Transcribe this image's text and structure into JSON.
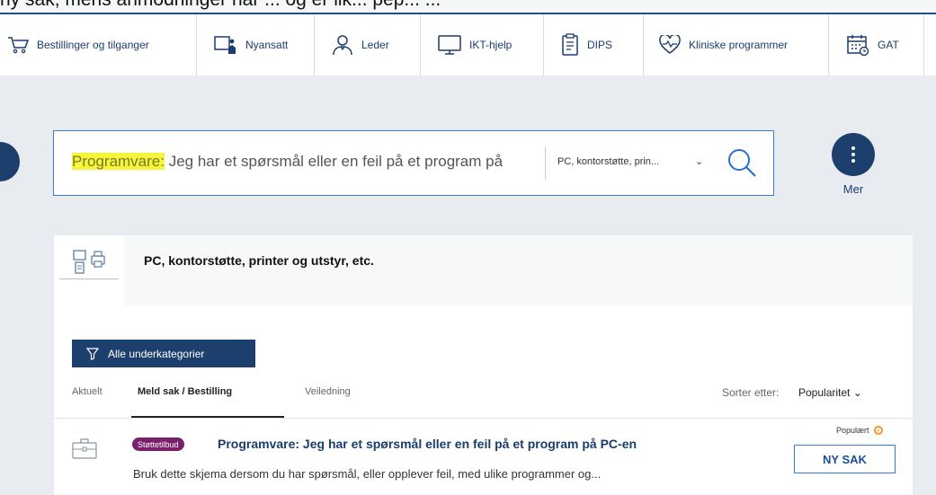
{
  "top_crop_text": "ny sak, mens anmodninger har ... og er lik... pep... ...",
  "nav": {
    "items": [
      {
        "label": "Bestillinger og tilganger",
        "icon": "cart-icon"
      },
      {
        "label": "Nyansatt",
        "icon": "new-employee-icon"
      },
      {
        "label": "Leder",
        "icon": "manager-icon"
      },
      {
        "label": "IKT-hjelp",
        "icon": "monitor-icon"
      },
      {
        "label": "DIPS",
        "icon": "clipboard-icon"
      },
      {
        "label": "Kliniske programmer",
        "icon": "heartbeat-icon"
      },
      {
        "label": "GAT",
        "icon": "calendar-icon"
      }
    ]
  },
  "search": {
    "highlight": "Programvare:",
    "query": " Jeg har et spørsmål eller en feil på et program på",
    "category": "PC, kontorstøtte, prin...",
    "chevron": "⌄"
  },
  "more": {
    "label": "Mer"
  },
  "category": {
    "title": "PC, kontorstøtte, printer og utstyr, etc."
  },
  "subcategories_button": "Alle underkategorier",
  "tabs": [
    {
      "label": "Aktuelt",
      "active": false
    },
    {
      "label": "Meld sak / Bestilling",
      "active": true
    },
    {
      "label": "Veiledning",
      "active": false
    }
  ],
  "sort": {
    "label": "Sorter etter:",
    "value": "Popularitet ⌄"
  },
  "result": {
    "badge": "Støttetilbud",
    "title": "Programvare: Jeg har et spørsmål eller en feil på et program på PC-en",
    "description": "Bruk dette skjema dersom du har spørsmål, eller opplever feil, med ulike programmer og...",
    "popular_label": "Populært",
    "button": "NY SAK"
  },
  "colors": {
    "navy": "#1d3f6e",
    "accent": "#3a7bd5",
    "badge": "#7a1f6a",
    "highlight": "#f5f53a",
    "popular": "#f39a2b"
  }
}
